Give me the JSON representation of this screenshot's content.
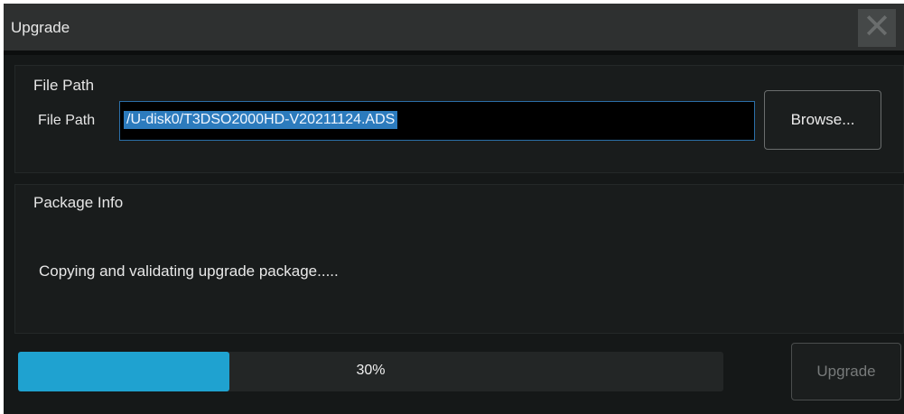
{
  "dialog": {
    "title": "Upgrade",
    "close_icon": "close-icon"
  },
  "file_path_group": {
    "label": "File Path",
    "field_label": "File Path",
    "value": "/U-disk0/T3DSO2000HD-V20211124.ADS",
    "browse_label": "Browse..."
  },
  "package_info_group": {
    "label": "Package Info",
    "status": "Copying and validating upgrade package....."
  },
  "progress": {
    "value": 0.3,
    "label": "30%",
    "color": "#1fa2d0"
  },
  "upgrade_button": {
    "label": "Upgrade",
    "enabled": false
  }
}
